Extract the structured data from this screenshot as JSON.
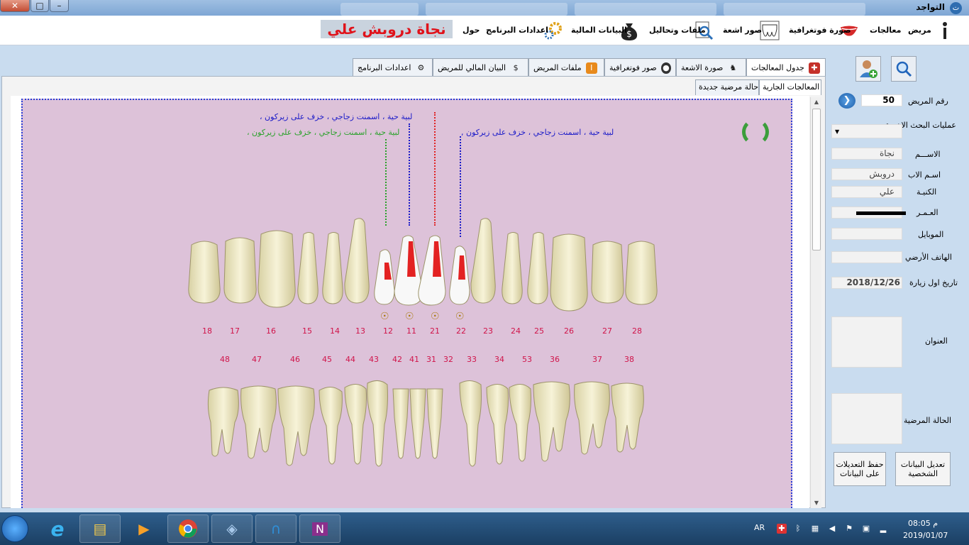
{
  "window": {
    "title": "التواجد",
    "close": "✕",
    "max": "□",
    "min": "–"
  },
  "menubar": {
    "items": [
      "مريض",
      "معالجات",
      "صورة فوتغرافية",
      "صور اشعة",
      "ملفات وتحاليل",
      "البيانات المالية",
      "اعدادات البرنامج",
      "حول"
    ],
    "patient_name": "نجاة دروبش علي"
  },
  "tabs": [
    "جدول المعالجات",
    "صورة الاشعة",
    "صور فوتغرافية",
    "ملفات المريض",
    "البيان المالي للمريض",
    "اعدادات البرنامج"
  ],
  "subtabs": [
    "المعالجات الجارية",
    "حالة مرضية جديدة"
  ],
  "chart": {
    "notes": [
      {
        "text": "لبية حية ، اسمنت زجاجي ، خزف على زيركون ،",
        "color": "blue"
      },
      {
        "text": "لبية حية ، اسمنت زجاجي ، خزف على زيركون ،",
        "color": "green"
      },
      {
        "text": "لبية حية ، اسمنت زجاجي ، خزف على زيركون ,",
        "color": "blue"
      }
    ],
    "upper_numbers": [
      "18",
      "17",
      "16",
      "15",
      "14",
      "13",
      "12",
      "11",
      "21",
      "22",
      "23",
      "24",
      "25",
      "26",
      "27",
      "28"
    ],
    "lower_numbers": [
      "48",
      "47",
      "46",
      "45",
      "44",
      "43",
      "42",
      "41",
      "31",
      "32",
      "33",
      "34",
      "53",
      "36",
      "37",
      "38"
    ]
  },
  "patient": {
    "number_label": "رقم المريض",
    "number_value": "50",
    "recent_label": "عمليات البحث الاخيرة",
    "name_label": "الاســـم",
    "name_value": "نجاة",
    "father_label": "اسـم الاب",
    "father_value": "دروبش",
    "surname_label": "الكنيـة",
    "surname_value": "علي",
    "age_label": "العـمـر",
    "mobile_label": "الموبايل",
    "phone_label": "الهاتف الأرضي",
    "first_visit_label": "تاريخ اول زيارة",
    "first_visit_value": "2018/12/26",
    "address_label": "العنوان",
    "condition_label": "الحالة المرضية",
    "edit_button": "تعديل البيانات الشخصية",
    "save_button": "حفظ التعديلات على البيانات"
  },
  "taskbar": {
    "lang": "AR",
    "time": "08:05 م",
    "date": "2019/01/07"
  },
  "colors": {
    "chart_bg": "#ddc2d9",
    "banner_text": "#e0131b",
    "tooth_numbers": "#d0144a"
  }
}
